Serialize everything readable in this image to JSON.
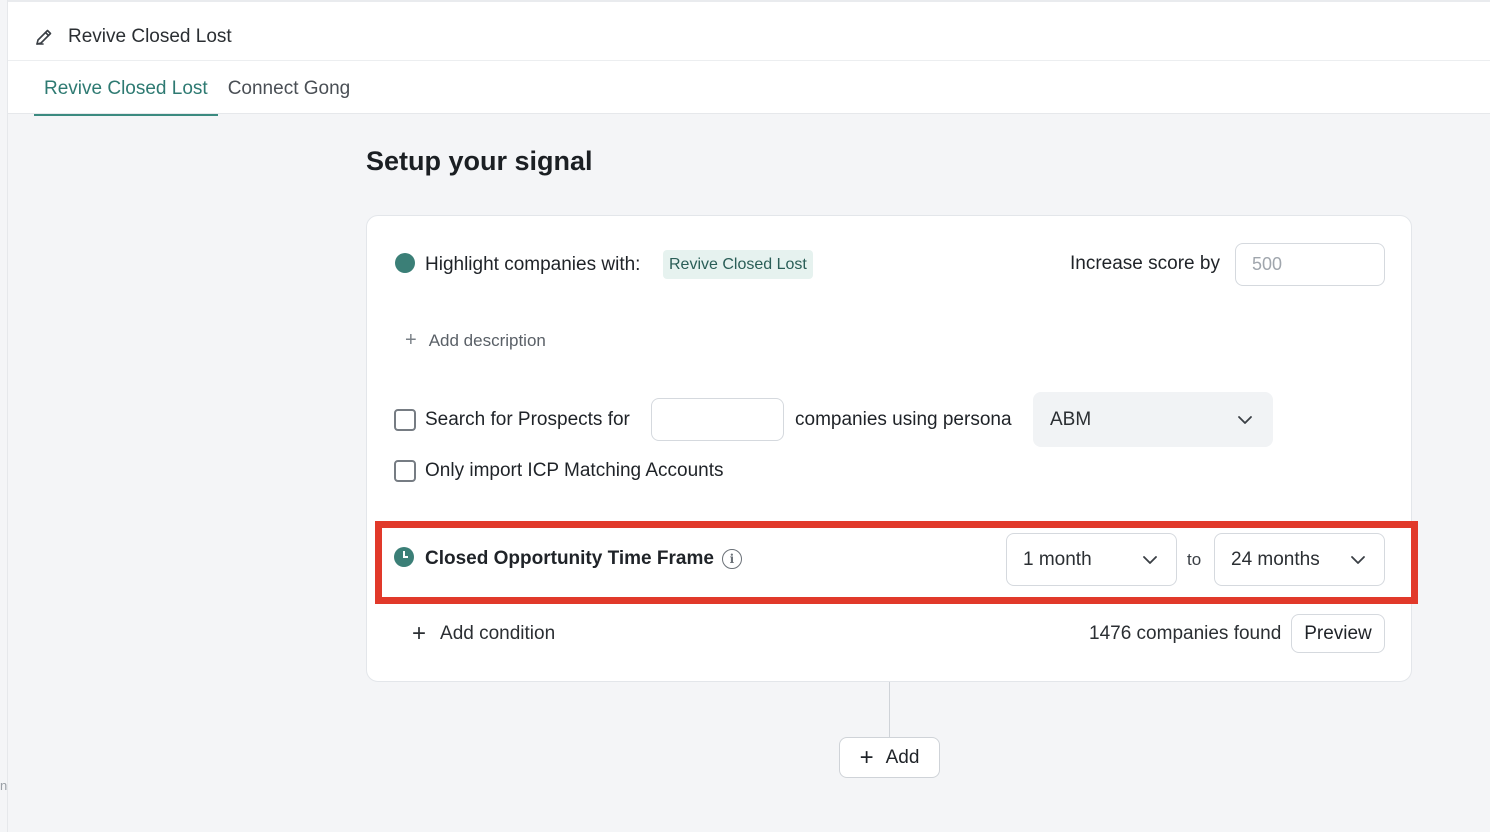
{
  "header": {
    "title": "Revive Closed Lost",
    "tabs": [
      {
        "label": "Revive Closed Lost",
        "active": true
      },
      {
        "label": "Connect Gong",
        "active": false
      }
    ]
  },
  "main": {
    "heading": "Setup your signal",
    "highlight": {
      "label": "Highlight companies with:",
      "tag": "Revive Closed Lost",
      "score_label": "Increase score by",
      "score_placeholder": "500",
      "score_value": ""
    },
    "add_description": "Add description",
    "prospects": {
      "label_before": "Search for Prospects for",
      "count_value": "",
      "label_after": "companies using persona",
      "persona": "ABM",
      "checked": false
    },
    "icp": {
      "label": "Only import ICP Matching Accounts",
      "checked": false
    },
    "time_frame": {
      "label": "Closed Opportunity Time Frame",
      "from": "1 month",
      "to_label": "to",
      "to": "24 months"
    },
    "add_condition": "Add condition",
    "companies_found": "1476 companies found",
    "preview": "Preview",
    "add": "Add"
  },
  "colors": {
    "accent": "#3b7f77",
    "tab_active": "#2e7a72",
    "highlight_border": "#e1392a",
    "tag_bg": "#e6f2ef"
  },
  "icons": [
    "pencil-icon",
    "plus-icon",
    "chevron-down-icon",
    "info-icon",
    "clock-icon"
  ]
}
